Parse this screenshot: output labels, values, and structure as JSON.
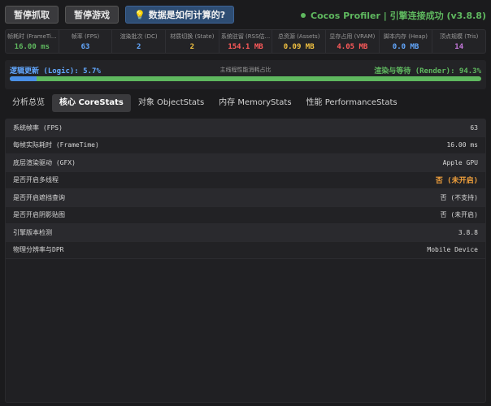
{
  "toolbar": {
    "pause_capture": "暂停抓取",
    "pause_game": "暂停游戏",
    "help_label": "数据是如何计算的?",
    "help_icon": "lightbulb-icon",
    "status_text": "Cocos Profiler | 引擎连接成功 (v3.8.8)",
    "status_color": "#5fb85f"
  },
  "stats": [
    {
      "label": "帧耗时 (FrameTi...",
      "value": "16.00 ms",
      "color": "#5fb85f"
    },
    {
      "label": "帧率 (FPS)",
      "value": "63",
      "color": "#63a8ff"
    },
    {
      "label": "渲染批次 (DC)",
      "value": "2",
      "color": "#63a8ff"
    },
    {
      "label": "材质切换 (State)",
      "value": "2",
      "color": "#f0c040"
    },
    {
      "label": "系统驻留 (RSS估...",
      "value": "154.1 MB",
      "color": "#ff5a5a"
    },
    {
      "label": "总资源 (Assets)",
      "value": "0.09 MB",
      "color": "#f0c040"
    },
    {
      "label": "显存占用 (VRAM)",
      "value": "4.05 MB",
      "color": "#ff5a5a"
    },
    {
      "label": "脚本内存 (Heap)",
      "value": "0.0 MB",
      "color": "#63a8ff"
    },
    {
      "label": "顶点规模 (Tris)",
      "value": "14",
      "color": "#c678dd"
    }
  ],
  "ratio": {
    "logic_label": "逻辑更新 (Logic): 5.7%",
    "center_label": "主线程性能消耗占比",
    "render_label": "渲染与等待 (Render): 94.3%",
    "logic_percent": 5.7
  },
  "tabs": [
    {
      "label": "分析总览",
      "active": false
    },
    {
      "label": "核心 CoreStats",
      "active": true
    },
    {
      "label": "对象 ObjectStats",
      "active": false
    },
    {
      "label": "内存 MemoryStats",
      "active": false
    },
    {
      "label": "性能 PerformanceStats",
      "active": false
    }
  ],
  "rows": [
    {
      "key": "系统帧率 (FPS)",
      "value": "63",
      "warn": false
    },
    {
      "key": "每帧实际耗时 (FrameTime)",
      "value": "16.00 ms",
      "warn": false
    },
    {
      "key": "底层渲染驱动 (GFX)",
      "value": "Apple GPU",
      "warn": false
    },
    {
      "key": "是否开启多线程",
      "value": "否 (未开启)",
      "warn": true
    },
    {
      "key": "是否开启遮挡查询",
      "value": "否 (不支持)",
      "warn": false
    },
    {
      "key": "是否开启阴影贴图",
      "value": "否 (未开启)",
      "warn": false
    },
    {
      "key": "引擎版本检测",
      "value": "3.8.8",
      "warn": false
    },
    {
      "key": "物理分辨率与DPR",
      "value": "Mobile Device",
      "warn": false
    }
  ]
}
